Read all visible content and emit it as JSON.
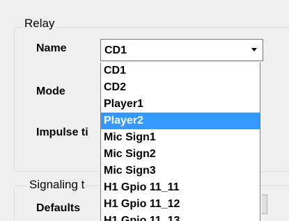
{
  "relay_group": {
    "title": "Relay",
    "name_label": "Name",
    "mode_label": "Mode",
    "impulse_label": "Impulse ti"
  },
  "name_combo": {
    "selected_value": "CD1",
    "icon": "chevron-down-icon",
    "options": [
      "CD1",
      "CD2",
      "Player1",
      "Player2",
      "Mic Sign1",
      "Mic Sign2",
      "Mic Sign3",
      "H1 Gpio 11_11",
      "H1 Gpio 11_12",
      "H1 Gpio 11_13"
    ],
    "highlighted_option": "Player2"
  },
  "signaling_group": {
    "title": "Signaling t",
    "defaults_label": "Defaults"
  },
  "colors": {
    "highlight": "#3399ff",
    "panel": "#f0f0f0"
  }
}
